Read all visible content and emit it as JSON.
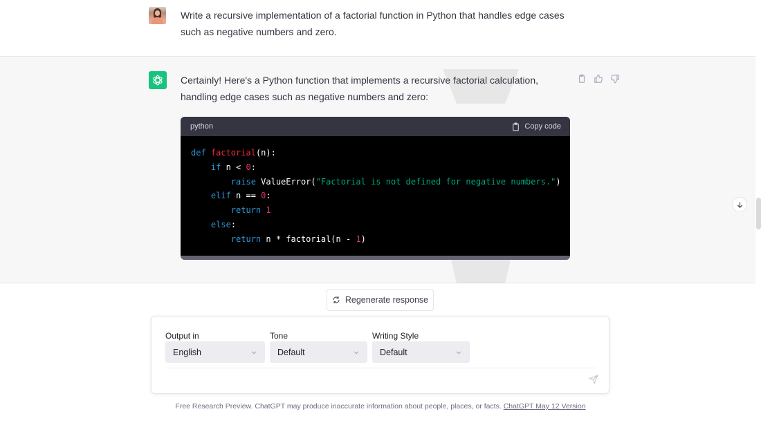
{
  "conversation": {
    "user_message": {
      "avatar": "user-avatar",
      "text": "Write a recursive implementation of a factorial function in Python that handles edge cases such as negative numbers and zero."
    },
    "assistant_message": {
      "avatar": "chatgpt-logo-icon",
      "text": "Certainly! Here's a Python function that implements a recursive factorial calculation, handling edge cases such as negative numbers and zero:",
      "actions": [
        "copy-icon",
        "thumbs-up-icon",
        "thumbs-down-icon"
      ],
      "code_block": {
        "language": "python",
        "copy_label": "Copy code",
        "lines": [
          "def factorial(n):",
          "    if n < 0:",
          "        raise ValueError(\"Factorial is not defined for negative numbers.\")",
          "    elif n == 0:",
          "        return 1",
          "    else:",
          "        return n * factorial(n - 1)"
        ]
      }
    }
  },
  "regenerate_label": "Regenerate response",
  "composer": {
    "output_in": {
      "label": "Output in",
      "value": "English"
    },
    "tone": {
      "label": "Tone",
      "value": "Default"
    },
    "writing_style": {
      "label": "Writing Style",
      "value": "Default"
    },
    "prompt_value": ""
  },
  "footer": {
    "text": "Free Research Preview. ChatGPT may produce inaccurate information about people, places, or facts. ",
    "link": "ChatGPT May 12 Version"
  },
  "colors": {
    "brand_green": "#19c37d",
    "code_keyword": "#2e95d3",
    "code_function": "#f22c3d",
    "code_number": "#df3079",
    "code_string": "#00a67d"
  }
}
